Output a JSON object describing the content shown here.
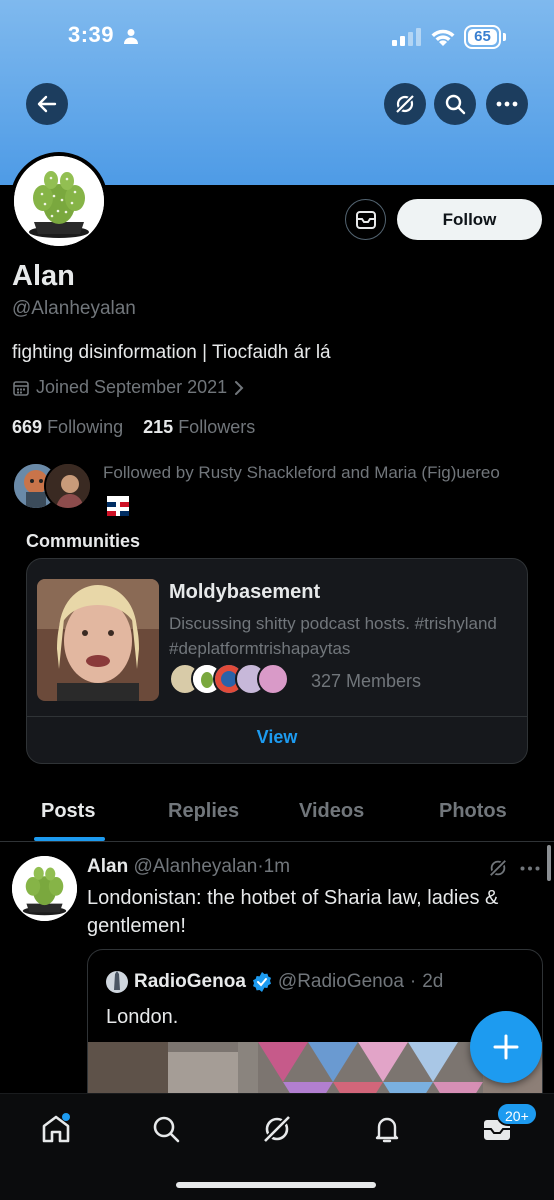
{
  "status_bar": {
    "time": "3:39",
    "battery": "65"
  },
  "profile": {
    "name": "Alan",
    "handle": "@Alanheyalan",
    "bio": "fighting disinformation | Tiocfaidh ár lá",
    "joined": "Joined September 2021",
    "following_count": "669",
    "following_label": "Following",
    "followers_count": "215",
    "followers_label": "Followers",
    "followed_by": "Followed by Rusty Shackleford and Maria (Fig)uereo",
    "follow_button": "Follow"
  },
  "communities": {
    "heading": "Communities",
    "card": {
      "title": "Moldybasement",
      "description": "Discussing shitty podcast hosts. #trishyland #deplatformtrishapaytas",
      "members": "327 Members",
      "view_label": "View"
    }
  },
  "tabs": [
    {
      "label": "Posts",
      "active": true
    },
    {
      "label": "Replies",
      "active": false
    },
    {
      "label": "Videos",
      "active": false
    },
    {
      "label": "Photos",
      "active": false
    }
  ],
  "post": {
    "author": "Alan",
    "handle": "@Alanheyalan",
    "time": "1m",
    "text": "Londonistan: the hotbet of Sharia law, ladies & gentlemen!",
    "quote": {
      "author": "RadioGenoa",
      "handle": "@RadioGenoa",
      "time": "2d",
      "text": "London."
    }
  },
  "bottom_nav": {
    "items": [
      "home-icon",
      "search-icon",
      "grok-icon",
      "notifications-icon",
      "messages-icon"
    ],
    "messages_badge": "20+"
  },
  "colors": {
    "accent": "#1d9bf0",
    "banner": "#4e9be6",
    "background": "#000000",
    "secondary_text": "#71767b"
  }
}
